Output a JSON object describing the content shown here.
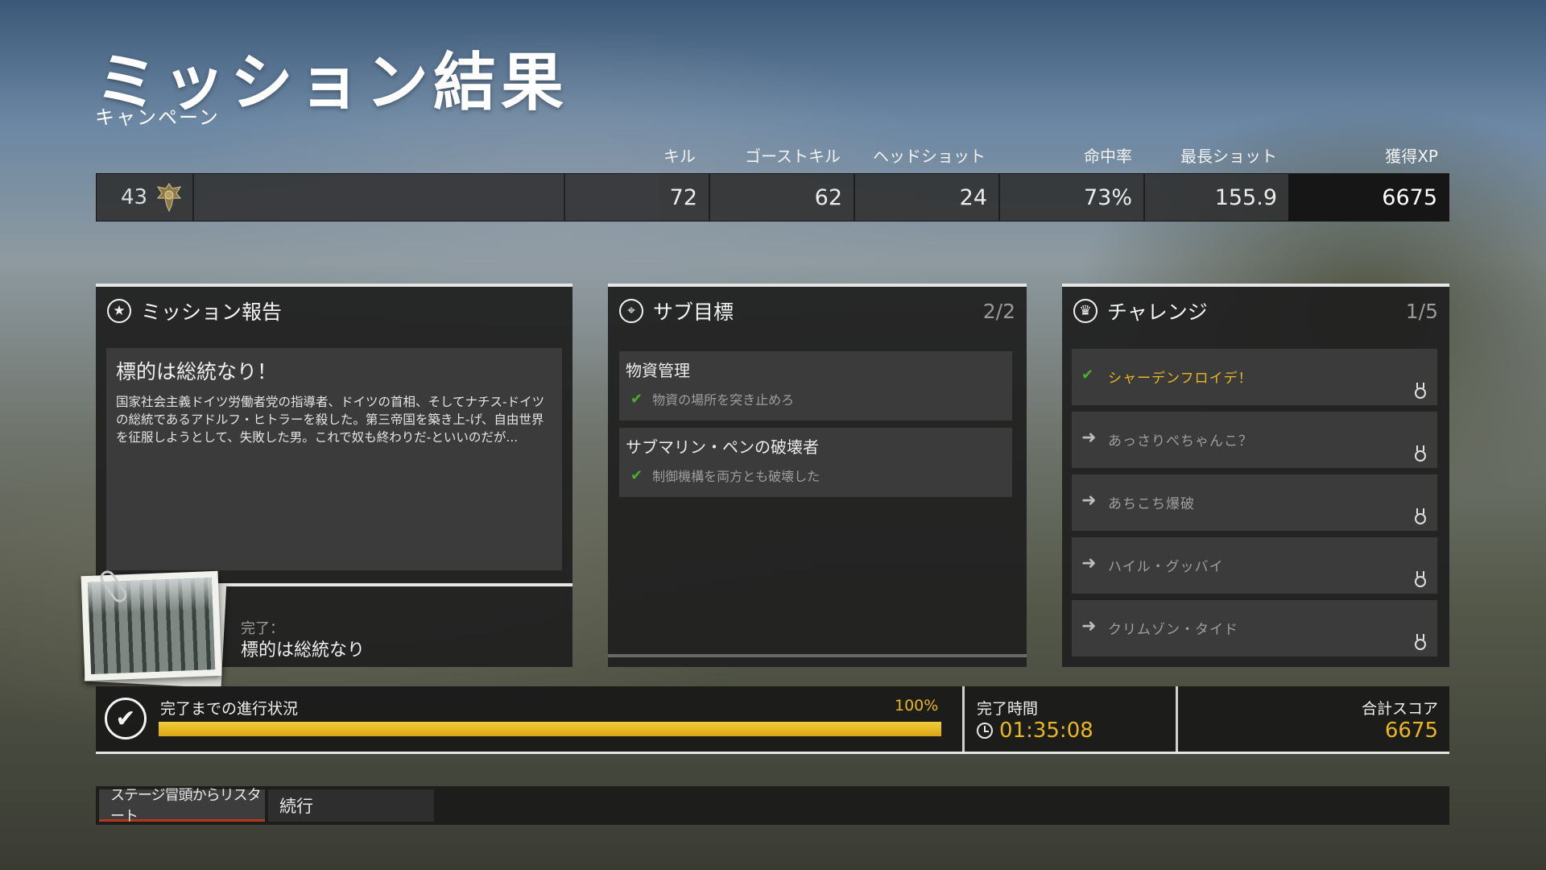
{
  "header": {
    "title": "ミッション結果",
    "subtitle": "キャンペーン"
  },
  "stats": {
    "rank": "43",
    "headers": {
      "kills": "キル",
      "ghost_kills": "ゴーストキル",
      "headshots": "ヘッドショット",
      "accuracy": "命中率",
      "longest_shot": "最長ショット",
      "xp": "獲得XP"
    },
    "values": {
      "kills": "72",
      "ghost_kills": "62",
      "headshots": "24",
      "accuracy": "73%",
      "longest_shot": "155.9",
      "xp": "6675"
    }
  },
  "mission_report": {
    "heading": "ミッション報告",
    "card_title": "標的は総統なり！",
    "card_body": "国家社会主義ドイツ労働者党の指導者、ドイツの首相、そしてナチス-ドイツの総統であるアドルフ・ヒトラーを殺した。第三帝国を築き上-げ、自由世界を征服しようとして、失敗した男。これで奴も終わりだ-といいのだが...",
    "completed_label": "完了：",
    "completed_value": "標的は総統なり"
  },
  "sub_objectives": {
    "heading": "サブ目標",
    "count": "2/2",
    "items": [
      {
        "title": "物資管理",
        "detail": "物資の場所を突き止めろ"
      },
      {
        "title": "サブマリン・ペンの破壊者",
        "detail": "制御機構を両方とも破壊した"
      }
    ]
  },
  "challenges": {
    "heading": "チャレンジ",
    "count": "1/5",
    "items": [
      {
        "label": "シャーデンフロイデ！",
        "done": true
      },
      {
        "label": "あっさりぺちゃんこ？",
        "done": false
      },
      {
        "label": "あちこち爆破",
        "done": false
      },
      {
        "label": "ハイル・グッバイ",
        "done": false
      },
      {
        "label": "クリムゾン・タイド",
        "done": false
      }
    ]
  },
  "progress": {
    "label": "完了までの進行状況",
    "percent_text": "100%",
    "fraction": 1.0,
    "time_label": "完了時間",
    "time_value": "01:35:08",
    "score_label": "合計スコア",
    "score_value": "6675"
  },
  "actions": {
    "restart_label": "ステージ冒頭からリスタート",
    "continue_label": "続行"
  },
  "colors": {
    "accent_gold": "#e8b81e",
    "check_green": "#4caf2a",
    "restart_underline": "#b1371f"
  }
}
